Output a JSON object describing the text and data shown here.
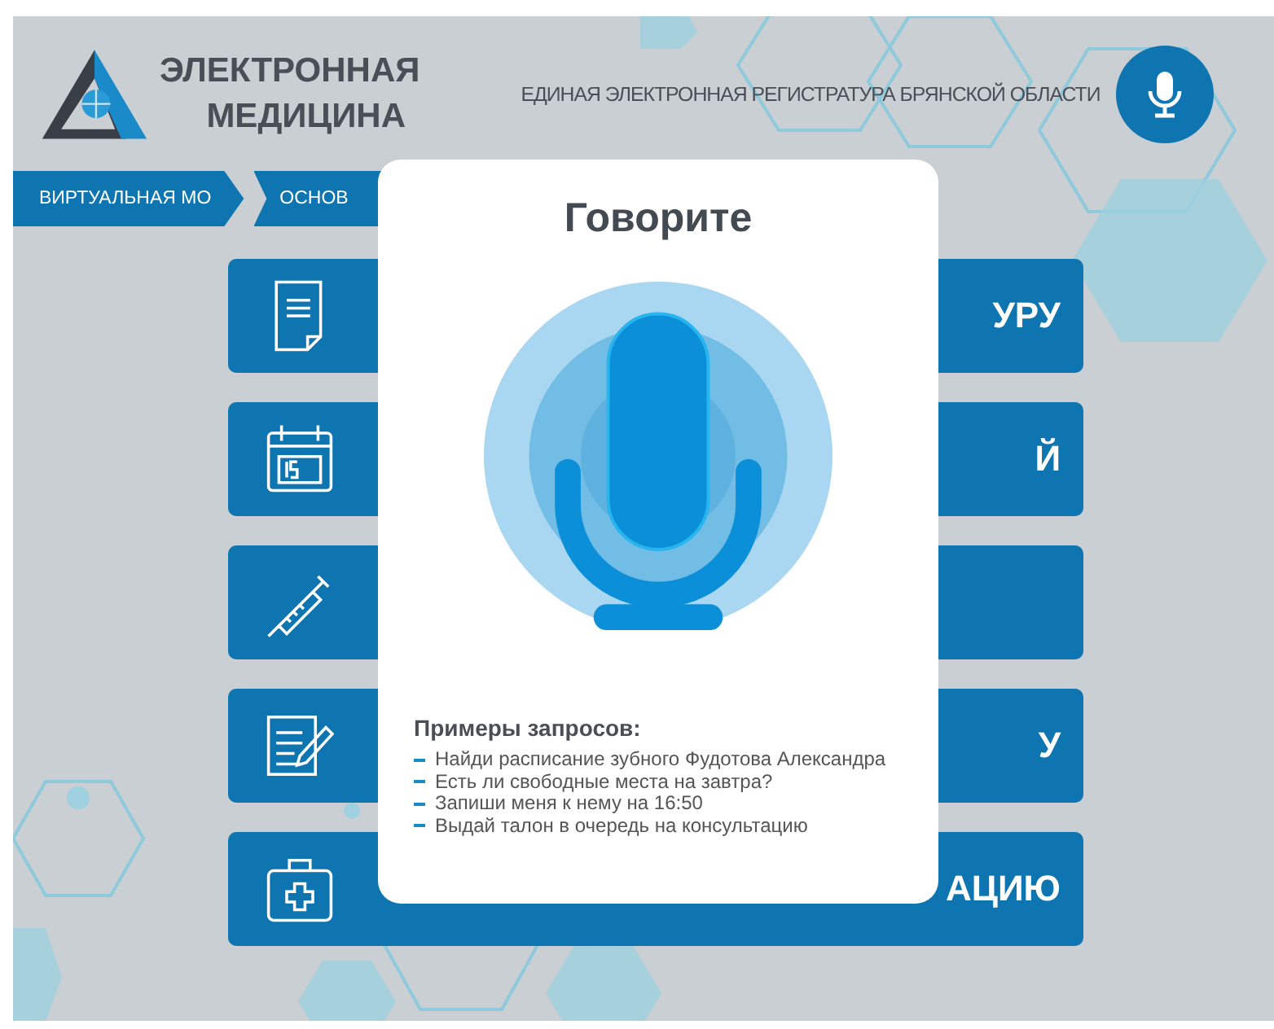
{
  "header": {
    "logo_lines": [
      "ЭЛЕКТРОННАЯ",
      "МЕДИЦИНА"
    ],
    "tagline": "ЕДИНАЯ ЭЛЕКТРОННАЯ РЕГИСТРАТУРА БРЯНСКОЙ ОБЛАСТИ"
  },
  "breadcrumbs": [
    "ВИРТУАЛЬНАЯ МО",
    "ОСНОВ"
  ],
  "menu": [
    {
      "kind": "document",
      "right": "УРУ"
    },
    {
      "kind": "calendar",
      "right": "Й"
    },
    {
      "kind": "syringe"
    },
    {
      "kind": "form",
      "right": "У"
    },
    {
      "kind": "kit",
      "right": "АЦИЮ"
    }
  ],
  "dialog": {
    "title": "Говорите",
    "examples_title": "Примеры запросов:",
    "examples": [
      "Найди расписание зубного Фудотова Александра",
      "Есть ли свободные места на завтра?",
      "Запиши меня к нему на 16:50",
      "Выдай талон в очередь на консультацию"
    ]
  }
}
